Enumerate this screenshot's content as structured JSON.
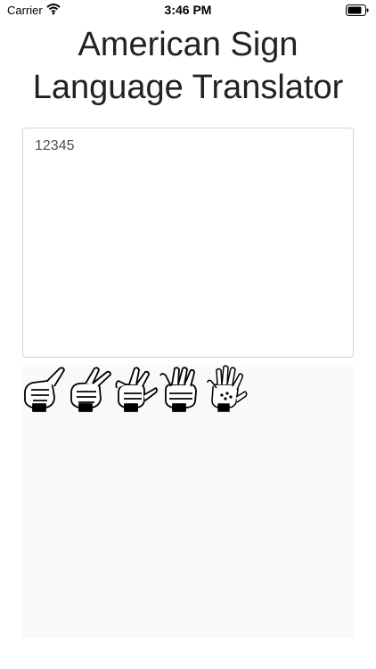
{
  "status_bar": {
    "carrier": "Carrier",
    "time": "3:46 PM",
    "wifi_icon": "wifi-icon",
    "battery_icon": "battery-icon"
  },
  "app": {
    "title_line1": "American Sign",
    "title_line2": "Language Translator"
  },
  "input": {
    "value": "12345"
  },
  "output": {
    "signs": [
      {
        "digit": "1",
        "icon": "asl-hand-sign-icon"
      },
      {
        "digit": "2",
        "icon": "asl-hand-sign-icon"
      },
      {
        "digit": "3",
        "icon": "asl-hand-sign-icon"
      },
      {
        "digit": "4",
        "icon": "asl-hand-sign-icon"
      },
      {
        "digit": "5",
        "icon": "asl-hand-sign-icon"
      }
    ]
  }
}
